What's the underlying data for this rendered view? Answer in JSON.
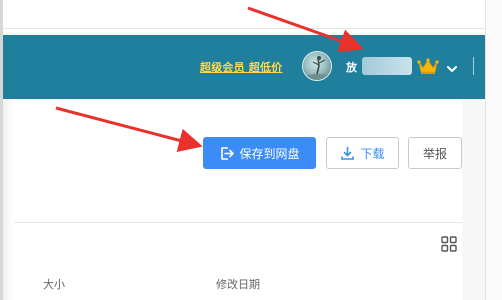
{
  "header": {
    "vip_link": "超级会员 超低价",
    "username_visible": "放",
    "colors": {
      "background": "#1f7f9d",
      "vip_link": "#ffd84d",
      "crown": "#f5b80a"
    },
    "icons": [
      "avatar",
      "crown-icon",
      "chevron-down-icon"
    ]
  },
  "toolbar": {
    "save_label": "保存到网盘",
    "download_label": "下载",
    "report_label": "举报",
    "colors": {
      "primary": "#3b8cf6"
    },
    "icons": [
      "save-to-cloud-icon",
      "download-icon"
    ]
  },
  "file_list": {
    "columns": [
      "大小",
      "修改日期"
    ],
    "view_toggle_icon": "grid-view-icon"
  },
  "annotations": {
    "arrow_color": "#e8322b"
  }
}
